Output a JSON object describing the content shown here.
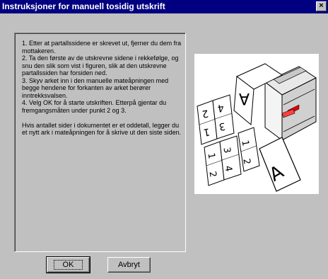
{
  "window": {
    "title": "Instruksjoner for manuell tosidig utskrift",
    "close_label": "×"
  },
  "instructions": {
    "step1": "1. Etter at partallssidene er skrevet ut, fjerner du dem fra mottakeren.",
    "step2": "2. Ta den første av de utskrevne sidene i rekkefølge, og snu den slik som vist i figuren, slik at den utskrevne partallssiden har forsiden ned.",
    "step3": "3. Skyv arket inn i den manuelle mateåpningen med begge hendene for forkanten av arket berører inntrekksvalsen.",
    "step4": "4. Velg OK for å starte utskriften. Etterpå gjentar du fremgangsmåten under punkt 2 og 3.",
    "note": " Hvis antallet sider i dokumentet er et oddetall, legger du et nytt ark i mateåpningen for å skrive ut den siste siden."
  },
  "illustration": {
    "page_numbers": [
      "2",
      "1",
      "4",
      "3",
      "1",
      "2",
      "3",
      "4",
      "4",
      "3"
    ]
  },
  "buttons": {
    "ok": "OK",
    "cancel": "Avbryt"
  }
}
